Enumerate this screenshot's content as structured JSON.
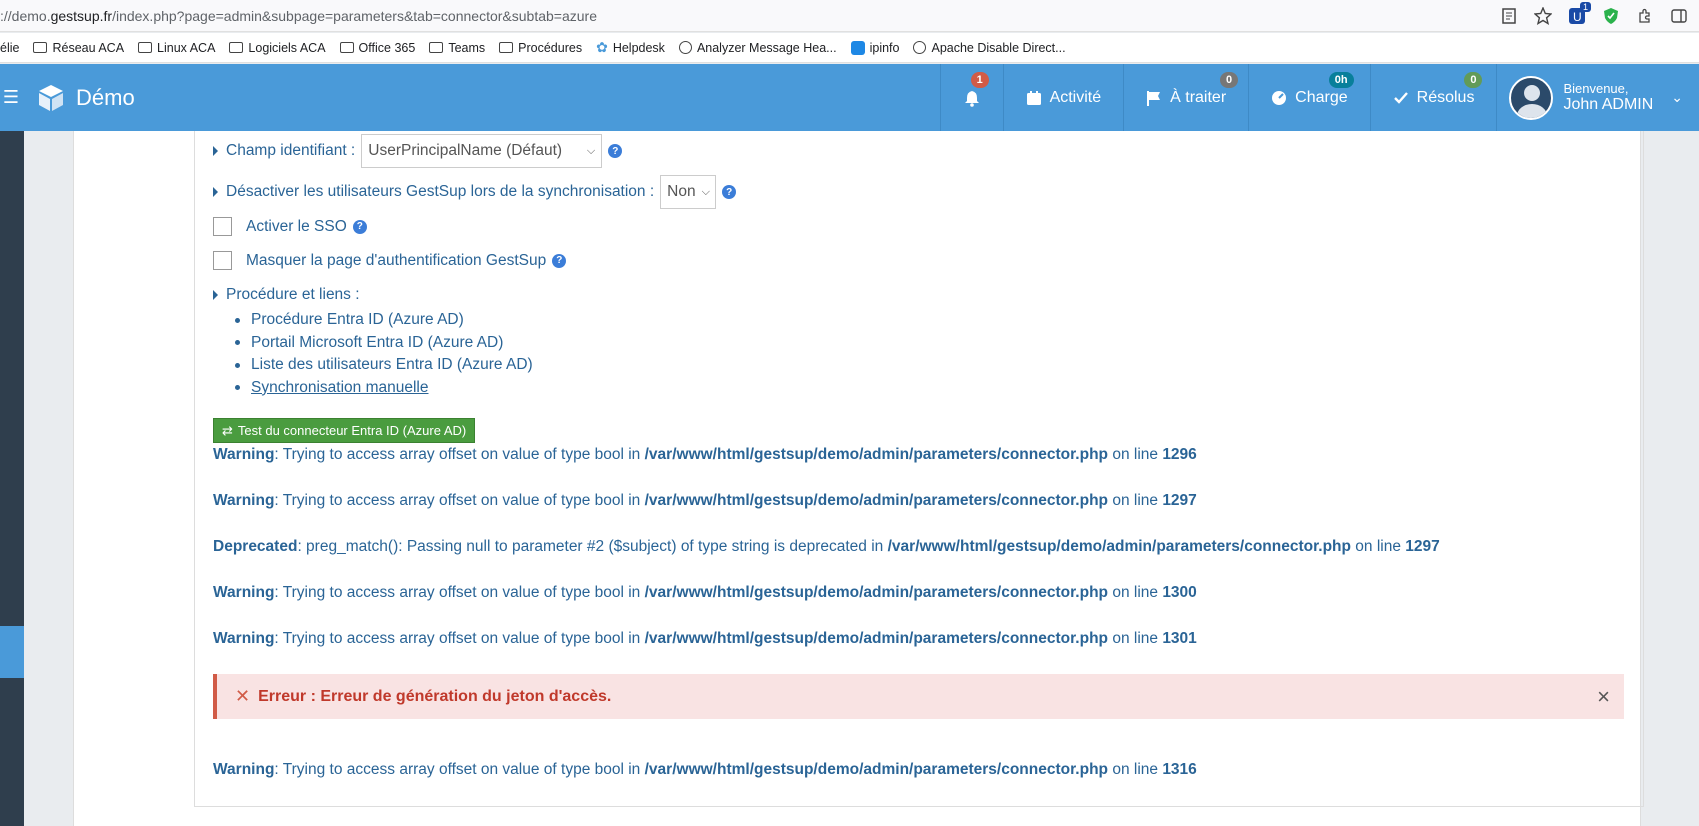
{
  "browser": {
    "url_prefix": "://demo.",
    "url_domain": "gestsup.fr",
    "url_rest": "/index.php?page=admin&subpage=parameters&tab=connector&subtab=azure",
    "bookmarks": [
      "élie",
      "Réseau ACA",
      "Linux ACA",
      "Logiciels ACA",
      "Office 365",
      "Teams",
      "Procédures",
      "Helpdesk",
      "Analyzer Message Hea...",
      "ipinfo",
      "Apache Disable Direct..."
    ],
    "ext_badge": "1"
  },
  "navbar": {
    "brand": "Démo",
    "notifications_count": "1",
    "activity_label": "Activité",
    "to_process_label": "À traiter",
    "to_process_count": "0",
    "load_label": "Charge",
    "load_badge": "0h",
    "resolved_label": "Résolus",
    "resolved_count": "0",
    "welcome": "Bienvenue,",
    "username": "John ADMIN"
  },
  "form": {
    "identifier_label": "Champ identifiant :",
    "identifier_value": "UserPrincipalName (Défaut)",
    "disable_users_label": "Désactiver les utilisateurs GestSup lors de la synchronisation :",
    "disable_users_value": "Non",
    "sso_label": "Activer le SSO",
    "hide_auth_label": "Masquer la page d'authentification GestSup",
    "procedure_label": "Procédure et liens :",
    "links": [
      "Procédure Entra ID (Azure AD)",
      "Portail Microsoft Entra ID (Azure AD)",
      "Liste des utilisateurs Entra ID (Azure AD)",
      "Synchronisation manuelle"
    ],
    "test_button": "Test du connecteur Entra ID (Azure AD)"
  },
  "messages": [
    {
      "level": "Warning",
      "text": ": Trying to access array offset on value of type bool in ",
      "file": "/var/www/html/gestsup/demo/admin/parameters/connector.php",
      "online": " on line ",
      "line": "1296"
    },
    {
      "level": "Warning",
      "text": ": Trying to access array offset on value of type bool in ",
      "file": "/var/www/html/gestsup/demo/admin/parameters/connector.php",
      "online": " on line ",
      "line": "1297"
    },
    {
      "level": "Deprecated",
      "text": ": preg_match(): Passing null to parameter #2 ($subject) of type string is deprecated in ",
      "file": "/var/www/html/gestsup/demo/admin/parameters/connector.php",
      "online": " on line ",
      "line": "1297"
    },
    {
      "level": "Warning",
      "text": ": Trying to access array offset on value of type bool in ",
      "file": "/var/www/html/gestsup/demo/admin/parameters/connector.php",
      "online": " on line ",
      "line": "1300"
    },
    {
      "level": "Warning",
      "text": ": Trying to access array offset on value of type bool in ",
      "file": "/var/www/html/gestsup/demo/admin/parameters/connector.php",
      "online": " on line ",
      "line": "1301"
    },
    {
      "level": "Warning",
      "text": ": Trying to access array offset on value of type bool in ",
      "file": "/var/www/html/gestsup/demo/admin/parameters/connector.php",
      "online": " on line ",
      "line": "1316"
    }
  ],
  "alert": {
    "text": "Erreur : Erreur de génération du jeton d'accès."
  },
  "help_glyph": "?",
  "colors": {
    "navbar": "#4a9ad9",
    "link": "#2a6496",
    "error": "#c0392b",
    "success_button": "#4a9c3f"
  }
}
